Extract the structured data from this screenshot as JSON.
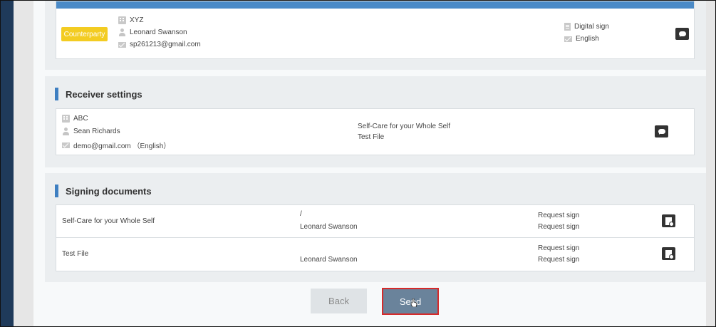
{
  "counterparty": {
    "badge": "Counterparty",
    "company": "XYZ",
    "name": "Leonard Swanson",
    "email": "sp261213@gmail.com",
    "sign_type": "Digital sign",
    "language": "English"
  },
  "receiver_settings": {
    "title": "Receiver settings",
    "company": "ABC",
    "name": "Sean Richards",
    "email_lang": "demo@gmail.com （English）",
    "documents": [
      "Self-Care for your Whole Self",
      "Test File"
    ]
  },
  "signing_documents": {
    "title": "Signing documents",
    "rows": [
      {
        "doc": "Self-Care for your Whole Self",
        "mark": "/",
        "signer": "Leonard Swanson",
        "action1": "Request sign",
        "action2": "Request sign"
      },
      {
        "doc": "Test File",
        "mark": "",
        "signer": "Leonard Swanson",
        "action1": "Request sign",
        "action2": "Request sign"
      }
    ]
  },
  "buttons": {
    "back": "Back",
    "send": "Send"
  },
  "colors": {
    "accent": "#3e7fc1",
    "badge": "#f3cc22",
    "send": "#6a839b",
    "highlight": "#d62b2b"
  },
  "icons": [
    "building-icon",
    "person-icon",
    "mail-icon",
    "document-icon",
    "chat-icon",
    "preview-icon",
    "cursor-icon"
  ]
}
